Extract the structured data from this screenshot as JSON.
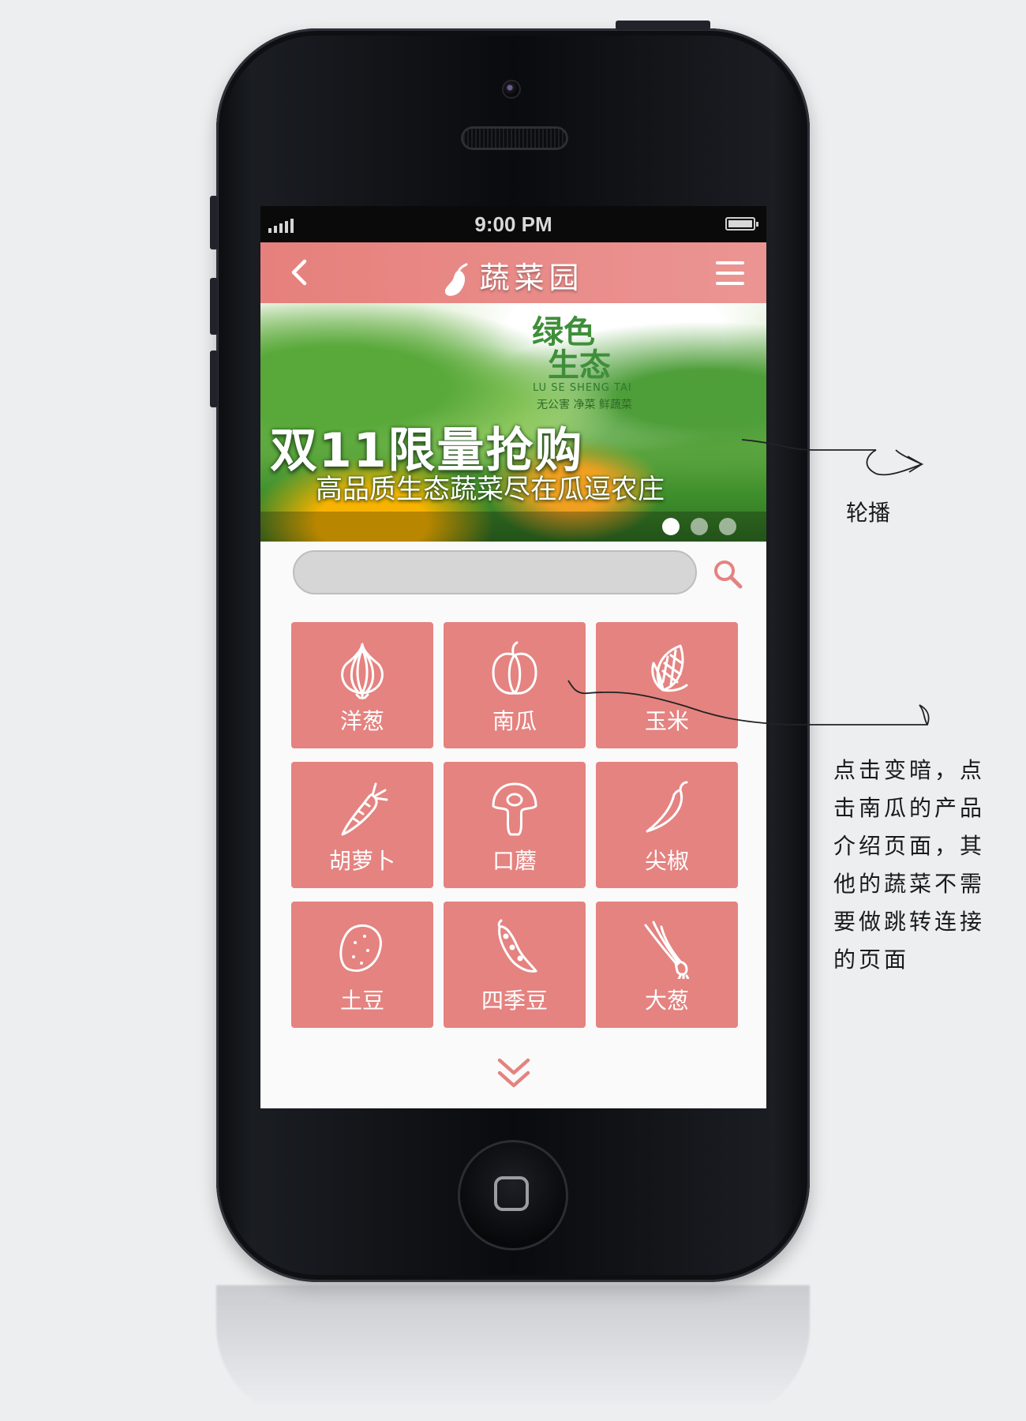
{
  "status_bar": {
    "time": "9:00 PM"
  },
  "nav": {
    "title": "蔬菜园"
  },
  "banner": {
    "logo_top": "绿色",
    "logo_bottom": "生态",
    "logo_en": "LU SE SHENG TAI",
    "logo_sub": "无公害  净菜  鲜蔬菜",
    "headline": "双11限量抢购",
    "subline": "高品质生态蔬菜尽在瓜逗农庄",
    "slide_count": 3,
    "active_slide": 0
  },
  "search": {
    "value": ""
  },
  "vegetables": [
    {
      "label": "洋葱",
      "icon": "onion-icon"
    },
    {
      "label": "南瓜",
      "icon": "pumpkin-icon"
    },
    {
      "label": "玉米",
      "icon": "corn-icon"
    },
    {
      "label": "胡萝卜",
      "icon": "carrot-icon"
    },
    {
      "label": "口蘑",
      "icon": "mushroom-icon"
    },
    {
      "label": "尖椒",
      "icon": "chili-icon"
    },
    {
      "label": "土豆",
      "icon": "potato-icon"
    },
    {
      "label": "四季豆",
      "icon": "bean-icon"
    },
    {
      "label": "大葱",
      "icon": "scallion-icon"
    }
  ],
  "annotations": {
    "carousel": "轮播",
    "note_lines": [
      "点击变暗，点",
      "击南瓜的产品",
      "介绍页面，其",
      "他的蔬菜不需",
      "要做跳转连接",
      "的页面"
    ]
  },
  "colors": {
    "accent": "#e48380",
    "nav": "#e6807c",
    "background": "#eceef0"
  }
}
